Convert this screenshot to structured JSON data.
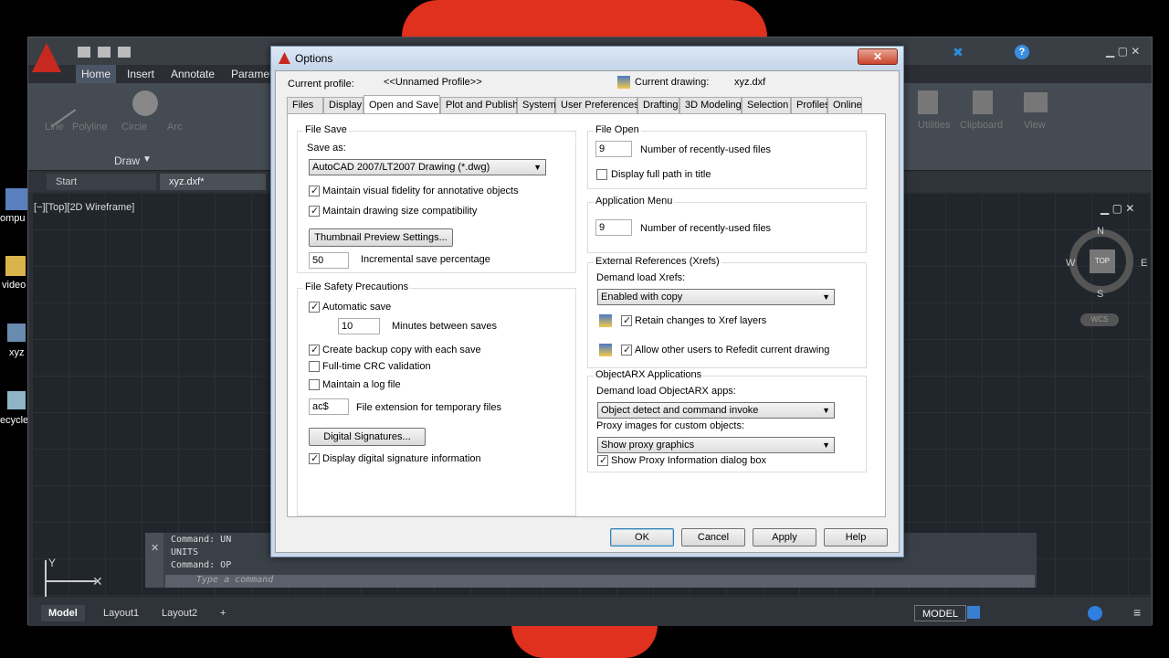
{
  "app": {
    "ribbon_tabs": [
      "Home",
      "Insert",
      "Annotate",
      "Paramet"
    ],
    "draw_panel_label": "Draw",
    "draw_tools": [
      "Line",
      "Polyline",
      "Circle",
      "Arc"
    ],
    "right_panels": [
      "Utilities",
      "Clipboard",
      "View"
    ],
    "doc_tabs": [
      "Start",
      "xyz.dxf*"
    ],
    "viewport_label": "[−][Top][2D Wireframe]",
    "viewcube": {
      "top": "TOP",
      "n": "N",
      "s": "S",
      "e": "E",
      "w": "W",
      "wcs": "WCS"
    },
    "command_lines": [
      "Command: UN",
      "UNITS",
      "Command: OP"
    ],
    "command_placeholder": "Type a command",
    "layout_tabs": [
      "Model",
      "Layout1",
      "Layout2"
    ],
    "add_layout": "+",
    "status_model": "MODEL",
    "desktop_icons": [
      "ompu",
      "video",
      "xyz",
      "ecycle"
    ]
  },
  "dialog": {
    "title": "Options",
    "close": "✕",
    "current_profile_label": "Current profile:",
    "current_profile_value": "<<Unnamed Profile>>",
    "current_drawing_label": "Current drawing:",
    "current_drawing_value": "xyz.dxf",
    "tabs": [
      "Files",
      "Display",
      "Open and Save",
      "Plot and Publish",
      "System",
      "User Preferences",
      "Drafting",
      "3D Modeling",
      "Selection",
      "Profiles",
      "Online"
    ],
    "active_tab": "Open and Save",
    "file_save": {
      "title": "File Save",
      "save_as_label": "Save as:",
      "save_as_value": "AutoCAD 2007/LT2007 Drawing (*.dwg)",
      "visual_fidelity": "Maintain visual fidelity for annotative objects",
      "drawing_size": "Maintain drawing size compatibility",
      "thumbnail_button": "Thumbnail Preview Settings...",
      "incremental_value": "50",
      "incremental_label": "Incremental save percentage"
    },
    "file_safety": {
      "title": "File Safety Precautions",
      "automatic_save": "Automatic save",
      "minutes_value": "10",
      "minutes_label": "Minutes between saves",
      "backup_copy": "Create backup copy with each save",
      "crc_validation": "Full-time CRC validation",
      "log_file": "Maintain a log file",
      "temp_ext_value": "ac$",
      "temp_ext_label": "File extension for temporary files",
      "digital_signatures_button": "Digital Signatures...",
      "display_signature": "Display digital signature information"
    },
    "file_open": {
      "title": "File Open",
      "recent_value": "9",
      "recent_label": "Number of recently-used files",
      "full_path": "Display full path in title"
    },
    "application_menu": {
      "title": "Application Menu",
      "recent_value": "9",
      "recent_label": "Number of recently-used files"
    },
    "xrefs": {
      "title": "External References (Xrefs)",
      "demand_load_label": "Demand load Xrefs:",
      "demand_load_value": "Enabled with copy",
      "retain_changes": "Retain changes to Xref layers",
      "allow_refedit": "Allow other users to Refedit current drawing"
    },
    "objectarx": {
      "title": "ObjectARX Applications",
      "demand_load_label": "Demand load ObjectARX apps:",
      "demand_load_value": "Object detect and command invoke",
      "proxy_label": "Proxy images for custom objects:",
      "proxy_value": "Show proxy graphics",
      "show_proxy_dialog": "Show Proxy Information dialog box"
    },
    "buttons": {
      "ok": "OK",
      "cancel": "Cancel",
      "apply": "Apply",
      "help": "Help"
    }
  }
}
